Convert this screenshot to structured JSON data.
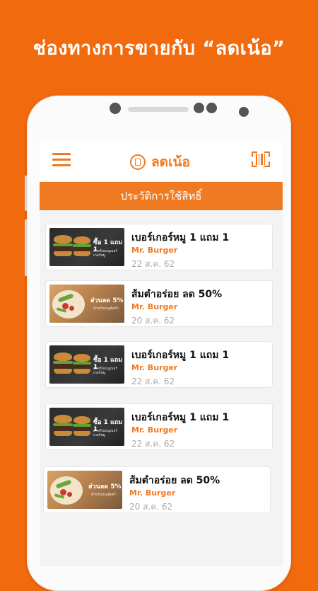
{
  "headline": "ช่องทางการขายกับ “ลดเน้อ”",
  "app": {
    "brand_name": "ลดเน้อ",
    "section_title": "ประวัติการใช้สิทธิ์",
    "accent_color": "#f07a22",
    "background_color": "#f26a0e",
    "menu_icon": "hamburger-menu-icon",
    "scan_icon": "barcode-scan-icon"
  },
  "history": [
    {
      "title": "เบอร์เกอร์หมู 1 แถม 1",
      "shop": "Mr. Burger",
      "date": "22 ส.ค. 62",
      "thumb_kind": "burger",
      "thumb_label": "ซื้อ 1 แถม 1",
      "thumb_sub": "สำหรับเมนูเบอร์เกอร์หมู"
    },
    {
      "title": "ส้มตำอร่อย ลด 50%",
      "shop": "Mr. Burger",
      "date": "20 ส.ค. 62",
      "thumb_kind": "somtam",
      "thumb_label": "ส่วนลด 5%",
      "thumb_sub": "สำหรับเมนูส้มตำ"
    },
    {
      "title": "เบอร์เกอร์หมู 1 แถม 1",
      "shop": "Mr. Burger",
      "date": "22 ส.ค. 62",
      "thumb_kind": "burger",
      "thumb_label": "ซื้อ 1 แถม 1",
      "thumb_sub": "สำหรับเมนูเบอร์เกอร์หมู"
    },
    {
      "title": "เบอร์เกอร์หมู 1 แถม 1",
      "shop": "Mr. Burger",
      "date": "22 ส.ค. 62",
      "thumb_kind": "burger",
      "thumb_label": "ซื้อ 1 แถม 1",
      "thumb_sub": "สำหรับเมนูเบอร์เกอร์หมู"
    },
    {
      "title": "ส้มตำอร่อย ลด 50%",
      "shop": "Mr. Burger",
      "date": "20 ส.ค. 62",
      "thumb_kind": "somtam",
      "thumb_label": "ส่วนลด 5%",
      "thumb_sub": "สำหรับเมนูส้มตำ"
    }
  ]
}
